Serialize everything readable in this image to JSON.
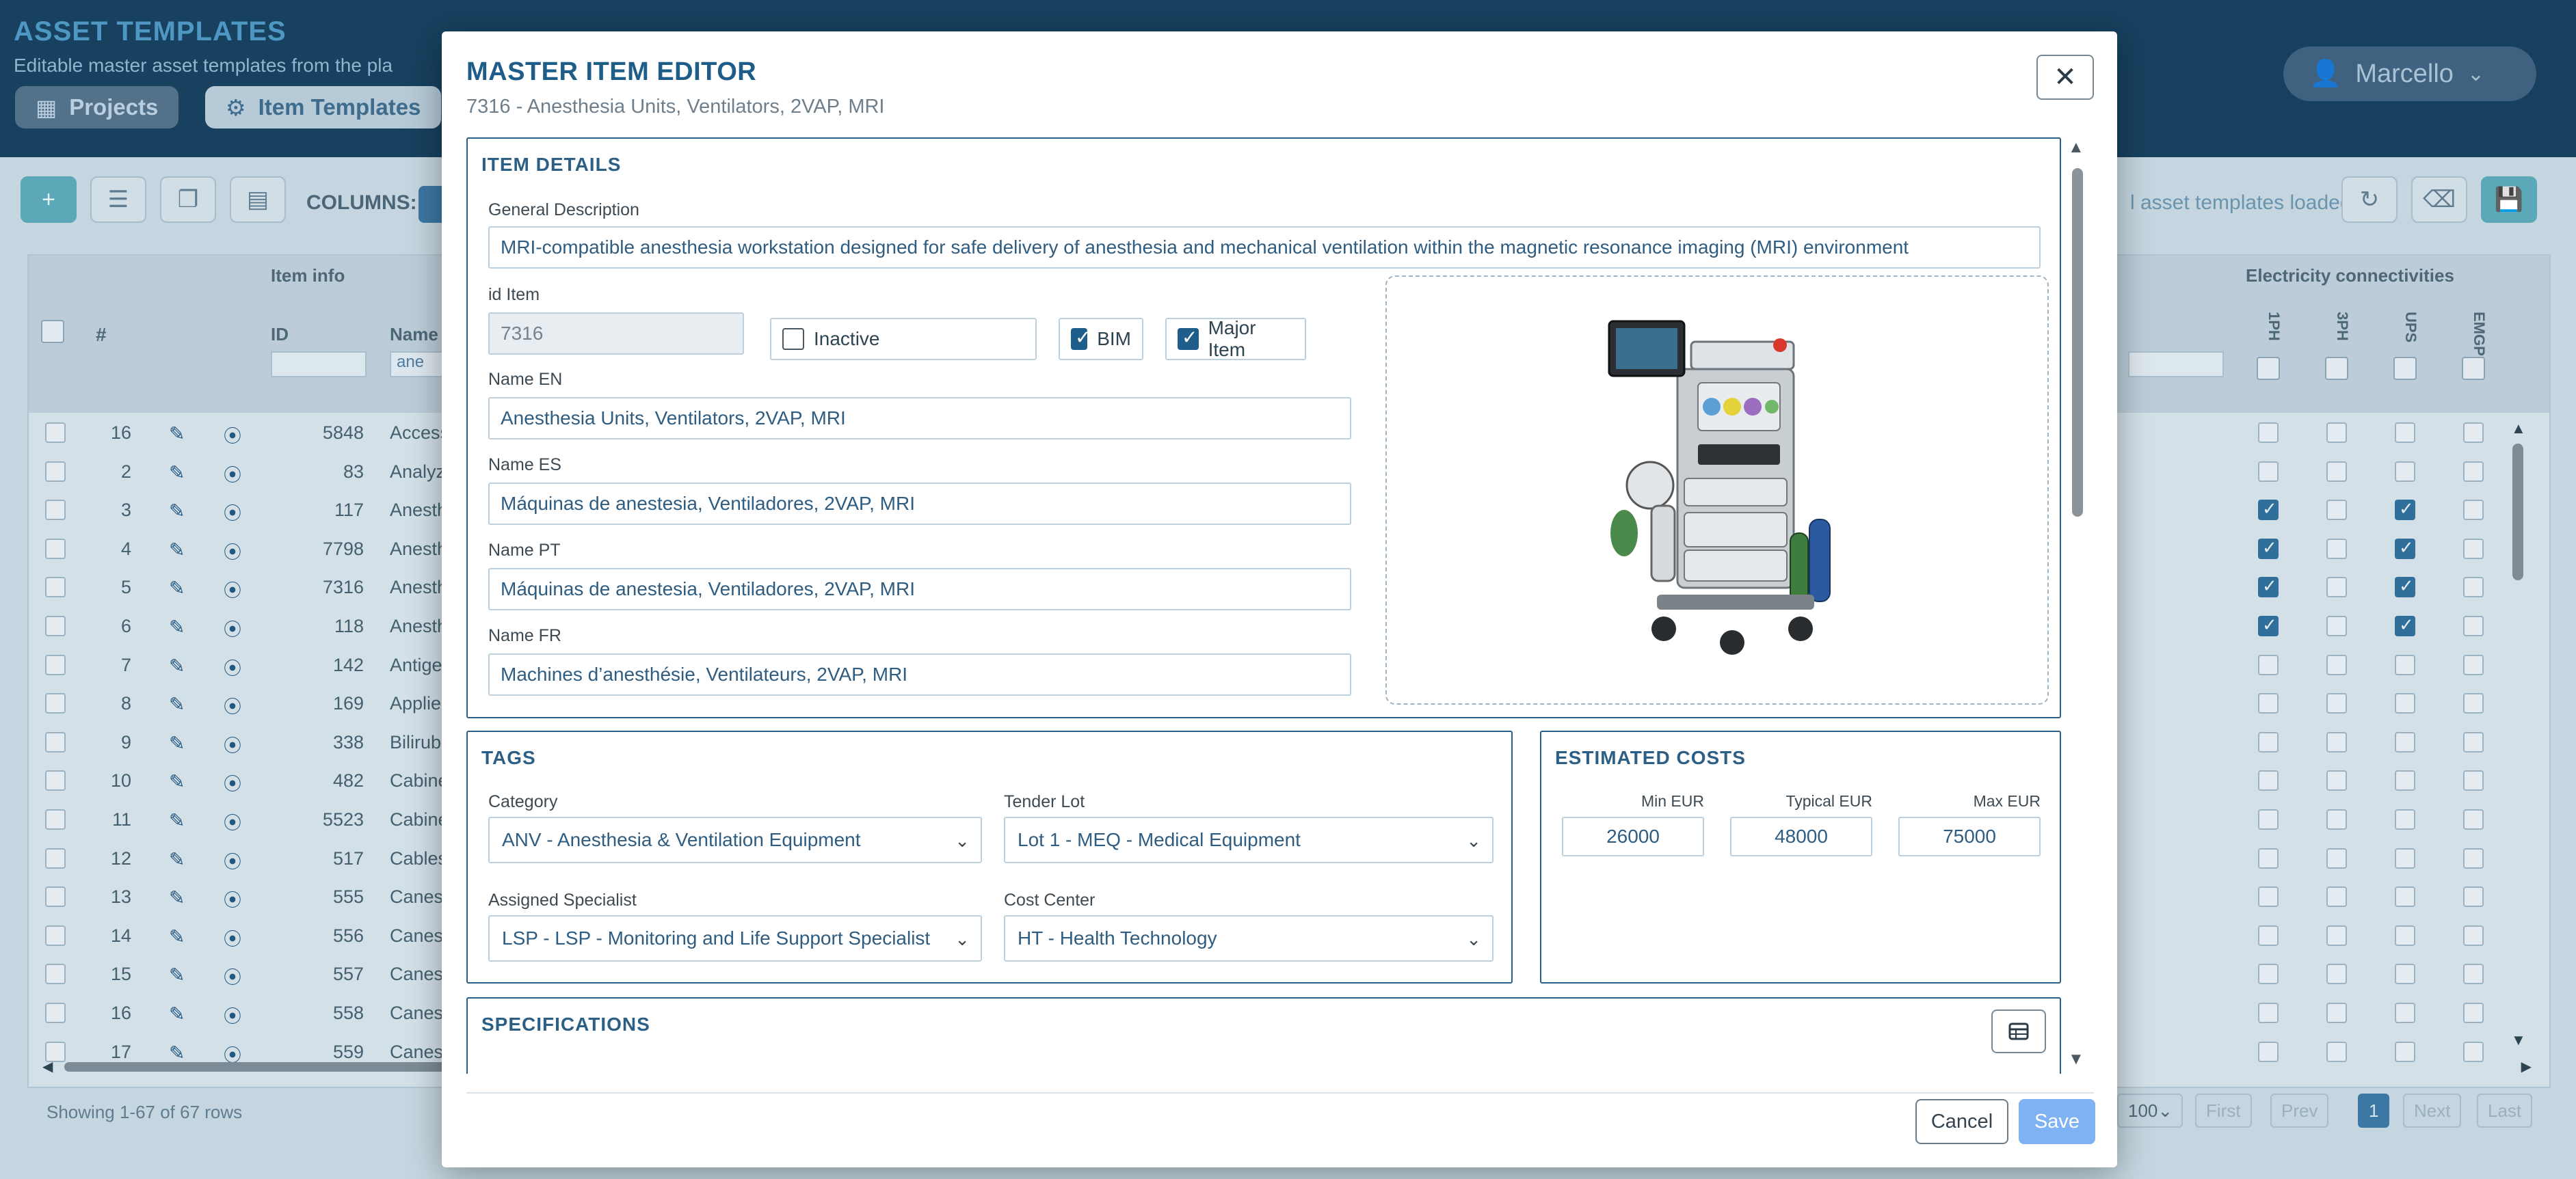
{
  "app": {
    "title": "ASSET TEMPLATES",
    "subtitle": "Editable master asset templates from the pla",
    "tabs": [
      {
        "label": "Projects"
      },
      {
        "label": "Item Templates"
      }
    ],
    "user": "Marcello"
  },
  "toolbar": {
    "columns_label": "COLUMNS:",
    "loaded_text": "l asset templates loaded"
  },
  "grid": {
    "group_item_info": "Item info",
    "group_electricity": "Electricity connectivities",
    "col_hash": "#",
    "col_id": "ID",
    "col_name": "Name I",
    "name_filter": "ane",
    "elec_cols": [
      "1PH",
      "3PH",
      "UPS",
      "EMGP"
    ],
    "rows": [
      {
        "num": "16",
        "id": "5848",
        "name": "Access",
        "elec": [
          false,
          false,
          false,
          false
        ]
      },
      {
        "num": "2",
        "id": "83",
        "name": "Analyz",
        "elec": [
          false,
          false,
          false,
          false
        ]
      },
      {
        "num": "3",
        "id": "117",
        "name": "Anesth",
        "elec": [
          true,
          false,
          true,
          false
        ]
      },
      {
        "num": "4",
        "id": "7798",
        "name": "Anesth",
        "elec": [
          true,
          false,
          true,
          false
        ]
      },
      {
        "num": "5",
        "id": "7316",
        "name": "Anesth",
        "elec": [
          true,
          false,
          true,
          false
        ]
      },
      {
        "num": "6",
        "id": "118",
        "name": "Anesth",
        "elec": [
          true,
          false,
          true,
          false
        ]
      },
      {
        "num": "7",
        "id": "142",
        "name": "Antige",
        "elec": [
          false,
          false,
          false,
          false
        ]
      },
      {
        "num": "8",
        "id": "169",
        "name": "Applier",
        "elec": [
          false,
          false,
          false,
          false
        ]
      },
      {
        "num": "9",
        "id": "338",
        "name": "Bilirub",
        "elec": [
          false,
          false,
          false,
          false
        ]
      },
      {
        "num": "10",
        "id": "482",
        "name": "Cabine",
        "elec": [
          false,
          false,
          false,
          false
        ]
      },
      {
        "num": "11",
        "id": "5523",
        "name": "Cabine",
        "elec": [
          false,
          false,
          false,
          false
        ]
      },
      {
        "num": "12",
        "id": "517",
        "name": "Cables",
        "elec": [
          false,
          false,
          false,
          false
        ]
      },
      {
        "num": "13",
        "id": "555",
        "name": "Canes",
        "elec": [
          false,
          false,
          false,
          false
        ]
      },
      {
        "num": "14",
        "id": "556",
        "name": "Canes,",
        "elec": [
          false,
          false,
          false,
          false
        ]
      },
      {
        "num": "15",
        "id": "557",
        "name": "Canes,",
        "elec": [
          false,
          false,
          false,
          false
        ]
      },
      {
        "num": "16",
        "id": "558",
        "name": "Canes,",
        "elec": [
          false,
          false,
          false,
          false
        ]
      },
      {
        "num": "17",
        "id": "559",
        "name": "Canes,",
        "elec": [
          false,
          false,
          false,
          false
        ]
      }
    ],
    "footer_text": "Showing 1-67 of 67 rows",
    "page_size": "100",
    "pager": {
      "first": "First",
      "prev": "Prev",
      "current": "1",
      "next": "Next",
      "last": "Last"
    }
  },
  "modal": {
    "title": "MASTER ITEM EDITOR",
    "subtitle": "7316 - Anesthesia Units, Ventilators, 2VAP, MRI",
    "item_details": {
      "heading": "ITEM DETAILS",
      "general_description_label": "General Description",
      "general_description": "MRI-compatible anesthesia workstation designed for safe delivery of anesthesia and mechanical ventilation within the magnetic resonance imaging (MRI) environment",
      "id_label": "id Item",
      "id_value": "7316",
      "inactive_label": "Inactive",
      "inactive": false,
      "bim_label": "BIM",
      "bim": true,
      "major_label": "Major Item",
      "major": true,
      "name_en_label": "Name EN",
      "name_en": "Anesthesia Units, Ventilators, 2VAP, MRI",
      "name_es_label": "Name ES",
      "name_es": "Máquinas de anestesia, Ventiladores, 2VAP, MRI",
      "name_pt_label": "Name PT",
      "name_pt": "Máquinas de anestesia, Ventiladores, 2VAP, MRI",
      "name_fr_label": "Name FR",
      "name_fr": "Machines d’anesthésie, Ventilateurs, 2VAP, MRI"
    },
    "tags": {
      "heading": "TAGS",
      "category_label": "Category",
      "category": "ANV - Anesthesia & Ventilation Equipment",
      "tender_label": "Tender Lot",
      "tender": "Lot 1 - MEQ - Medical Equipment",
      "specialist_label": "Assigned Specialist",
      "specialist": "LSP - LSP - Monitoring and Life Support Specialist",
      "cost_center_label": "Cost Center",
      "cost_center": "HT - Health Technology"
    },
    "costs": {
      "heading": "ESTIMATED COSTS",
      "min_label": "Min EUR",
      "typical_label": "Typical EUR",
      "max_label": "Max EUR",
      "min": "26000",
      "typical": "48000",
      "max": "75000"
    },
    "specifications": {
      "heading": "SPECIFICATIONS"
    },
    "cancel_label": "Cancel",
    "save_label": "Save"
  }
}
